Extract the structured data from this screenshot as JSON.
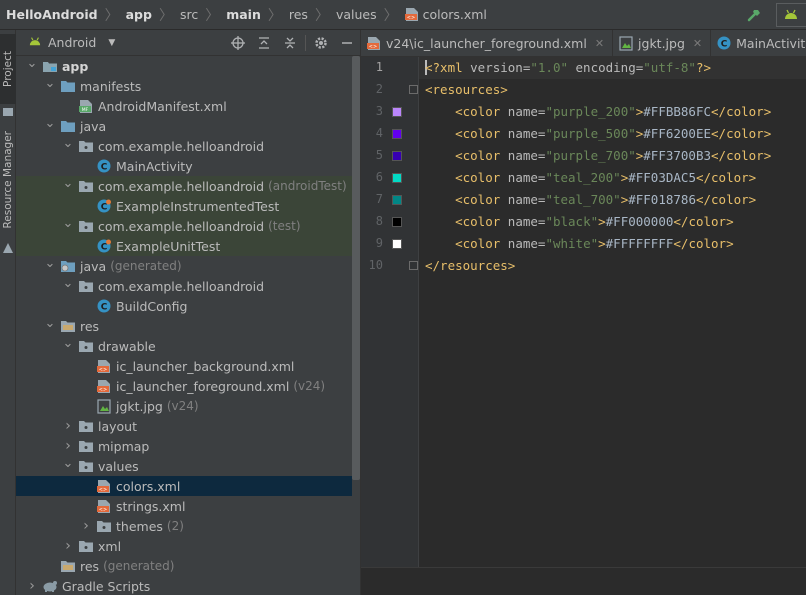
{
  "breadcrumb": [
    {
      "label": "HelloAndroid",
      "bold": true
    },
    {
      "label": "app",
      "bold": true
    },
    {
      "label": "src",
      "bold": false
    },
    {
      "label": "main",
      "bold": true
    },
    {
      "label": "res",
      "bold": false
    },
    {
      "label": "values",
      "bold": false
    },
    {
      "label": "colors.xml",
      "bold": false
    }
  ],
  "stripe": {
    "project_tab": "Project",
    "resource_manager_tab": "Resource Manager"
  },
  "project_panel": {
    "view_label": "Android",
    "icons": [
      "crosshair-icon",
      "expand-all-icon",
      "collapse-all-icon",
      "gear-icon",
      "minimize-icon"
    ]
  },
  "tree": [
    {
      "label": "app",
      "suffix": "",
      "indent": 0,
      "arrow": "open",
      "icon": "module-folder-icon",
      "bold": true,
      "state": ""
    },
    {
      "label": "manifests",
      "suffix": "",
      "indent": 1,
      "arrow": "open",
      "icon": "folder-icon",
      "bold": false,
      "state": ""
    },
    {
      "label": "AndroidManifest.xml",
      "suffix": "",
      "indent": 2,
      "arrow": "none",
      "icon": "manifest-file-icon",
      "bold": false,
      "state": ""
    },
    {
      "label": "java",
      "suffix": "",
      "indent": 1,
      "arrow": "open",
      "icon": "folder-icon",
      "bold": false,
      "state": ""
    },
    {
      "label": "com.example.helloandroid",
      "suffix": "",
      "indent": 2,
      "arrow": "open",
      "icon": "package-icon",
      "bold": false,
      "state": ""
    },
    {
      "label": "MainActivity",
      "suffix": "",
      "indent": 3,
      "arrow": "none",
      "icon": "class-icon",
      "bold": false,
      "state": ""
    },
    {
      "label": "com.example.helloandroid",
      "suffix": "(androidTest)",
      "indent": 2,
      "arrow": "open",
      "icon": "package-icon",
      "bold": false,
      "state": "hl"
    },
    {
      "label": "ExampleInstrumentedTest",
      "suffix": "",
      "indent": 3,
      "arrow": "none",
      "icon": "test-class-icon",
      "bold": false,
      "state": "hl"
    },
    {
      "label": "com.example.helloandroid",
      "suffix": "(test)",
      "indent": 2,
      "arrow": "open",
      "icon": "package-icon",
      "bold": false,
      "state": "hl"
    },
    {
      "label": "ExampleUnitTest",
      "suffix": "",
      "indent": 3,
      "arrow": "none",
      "icon": "test-class-icon",
      "bold": false,
      "state": "hl"
    },
    {
      "label": "java",
      "suffix": "(generated)",
      "indent": 1,
      "arrow": "open",
      "icon": "generated-folder-icon",
      "bold": false,
      "state": ""
    },
    {
      "label": "com.example.helloandroid",
      "suffix": "",
      "indent": 2,
      "arrow": "open",
      "icon": "package-icon",
      "bold": false,
      "state": ""
    },
    {
      "label": "BuildConfig",
      "suffix": "",
      "indent": 3,
      "arrow": "none",
      "icon": "class-icon",
      "bold": false,
      "state": ""
    },
    {
      "label": "res",
      "suffix": "",
      "indent": 1,
      "arrow": "open",
      "icon": "res-folder-icon",
      "bold": false,
      "state": ""
    },
    {
      "label": "drawable",
      "suffix": "",
      "indent": 2,
      "arrow": "open",
      "icon": "package-icon",
      "bold": false,
      "state": ""
    },
    {
      "label": "ic_launcher_background.xml",
      "suffix": "",
      "indent": 3,
      "arrow": "none",
      "icon": "xml-file-icon",
      "bold": false,
      "state": ""
    },
    {
      "label": "ic_launcher_foreground.xml",
      "suffix": "(v24)",
      "indent": 3,
      "arrow": "none",
      "icon": "xml-file-icon",
      "bold": false,
      "state": ""
    },
    {
      "label": "jgkt.jpg",
      "suffix": "(v24)",
      "indent": 3,
      "arrow": "none",
      "icon": "image-file-icon",
      "bold": false,
      "state": ""
    },
    {
      "label": "layout",
      "suffix": "",
      "indent": 2,
      "arrow": "closed",
      "icon": "package-icon",
      "bold": false,
      "state": ""
    },
    {
      "label": "mipmap",
      "suffix": "",
      "indent": 2,
      "arrow": "closed",
      "icon": "package-icon",
      "bold": false,
      "state": ""
    },
    {
      "label": "values",
      "suffix": "",
      "indent": 2,
      "arrow": "open",
      "icon": "package-icon",
      "bold": false,
      "state": ""
    },
    {
      "label": "colors.xml",
      "suffix": "",
      "indent": 3,
      "arrow": "none",
      "icon": "xml-file-icon",
      "bold": false,
      "state": "sel"
    },
    {
      "label": "strings.xml",
      "suffix": "",
      "indent": 3,
      "arrow": "none",
      "icon": "xml-file-icon",
      "bold": false,
      "state": ""
    },
    {
      "label": "themes",
      "suffix": "(2)",
      "indent": 3,
      "arrow": "closed",
      "icon": "package-icon",
      "bold": false,
      "state": ""
    },
    {
      "label": "xml",
      "suffix": "",
      "indent": 2,
      "arrow": "closed",
      "icon": "package-icon",
      "bold": false,
      "state": ""
    },
    {
      "label": "res",
      "suffix": "(generated)",
      "indent": 1,
      "arrow": "none",
      "icon": "res-folder-icon",
      "bold": false,
      "state": ""
    },
    {
      "label": "Gradle Scripts",
      "suffix": "",
      "indent": 0,
      "arrow": "closed",
      "icon": "gradle-icon",
      "bold": false,
      "state": ""
    }
  ],
  "editor_tabs": [
    {
      "label": "v24\\ic_launcher_foreground.xml",
      "icon": "xml-file-icon",
      "closable": true
    },
    {
      "label": "jgkt.jpg",
      "icon": "image-file-icon",
      "closable": true
    },
    {
      "label": "MainActivity.java",
      "icon": "class-icon",
      "closable": false
    }
  ],
  "code_lines": [
    {
      "num": "1",
      "swatch": "",
      "tokens": [
        [
          "caret",
          ""
        ],
        [
          "tag",
          "<?xml "
        ],
        [
          "attr",
          "version="
        ],
        [
          "str",
          "\"1.0\" "
        ],
        [
          "attr",
          "encoding="
        ],
        [
          "str",
          "\"utf-8\""
        ],
        [
          "tag",
          "?>"
        ]
      ]
    },
    {
      "num": "2",
      "swatch": "",
      "tokens": [
        [
          "tag",
          "<resources>"
        ]
      ]
    },
    {
      "num": "3",
      "swatch": "#BB86FC",
      "tokens": [
        [
          "txt",
          "    "
        ],
        [
          "tag",
          "<color "
        ],
        [
          "attr",
          "name="
        ],
        [
          "str",
          "\"purple_200\""
        ],
        [
          "tag",
          ">"
        ],
        [
          "txt",
          "#FFBB86FC"
        ],
        [
          "tag",
          "</color>"
        ]
      ]
    },
    {
      "num": "4",
      "swatch": "#6200EE",
      "tokens": [
        [
          "txt",
          "    "
        ],
        [
          "tag",
          "<color "
        ],
        [
          "attr",
          "name="
        ],
        [
          "str",
          "\"purple_500\""
        ],
        [
          "tag",
          ">"
        ],
        [
          "txt",
          "#FF6200EE"
        ],
        [
          "tag",
          "</color>"
        ]
      ]
    },
    {
      "num": "5",
      "swatch": "#3700B3",
      "tokens": [
        [
          "txt",
          "    "
        ],
        [
          "tag",
          "<color "
        ],
        [
          "attr",
          "name="
        ],
        [
          "str",
          "\"purple_700\""
        ],
        [
          "tag",
          ">"
        ],
        [
          "txt",
          "#FF3700B3"
        ],
        [
          "tag",
          "</color>"
        ]
      ]
    },
    {
      "num": "6",
      "swatch": "#03DAC5",
      "tokens": [
        [
          "txt",
          "    "
        ],
        [
          "tag",
          "<color "
        ],
        [
          "attr",
          "name="
        ],
        [
          "str",
          "\"teal_200\""
        ],
        [
          "tag",
          ">"
        ],
        [
          "txt",
          "#FF03DAC5"
        ],
        [
          "tag",
          "</color>"
        ]
      ]
    },
    {
      "num": "7",
      "swatch": "#018786",
      "tokens": [
        [
          "txt",
          "    "
        ],
        [
          "tag",
          "<color "
        ],
        [
          "attr",
          "name="
        ],
        [
          "str",
          "\"teal_700\""
        ],
        [
          "tag",
          ">"
        ],
        [
          "txt",
          "#FF018786"
        ],
        [
          "tag",
          "</color>"
        ]
      ]
    },
    {
      "num": "8",
      "swatch": "#000000",
      "tokens": [
        [
          "txt",
          "    "
        ],
        [
          "tag",
          "<color "
        ],
        [
          "attr",
          "name="
        ],
        [
          "str",
          "\"black\""
        ],
        [
          "tag",
          ">"
        ],
        [
          "txt",
          "#FF000000"
        ],
        [
          "tag",
          "</color>"
        ]
      ]
    },
    {
      "num": "9",
      "swatch": "#FFFFFF",
      "tokens": [
        [
          "txt",
          "    "
        ],
        [
          "tag",
          "<color "
        ],
        [
          "attr",
          "name="
        ],
        [
          "str",
          "\"white\""
        ],
        [
          "tag",
          ">"
        ],
        [
          "txt",
          "#FFFFFFFF"
        ],
        [
          "tag",
          "</color>"
        ]
      ]
    },
    {
      "num": "10",
      "swatch": "",
      "tokens": [
        [
          "tag",
          "</resources>"
        ]
      ]
    }
  ]
}
